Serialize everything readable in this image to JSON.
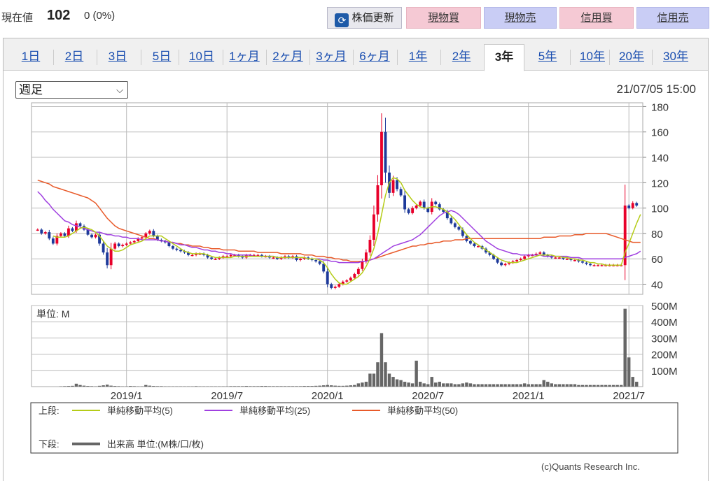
{
  "header": {
    "price_label": "現在値",
    "price_value": "102",
    "price_change": "0 (0%)",
    "buttons": {
      "refresh": "株価更新",
      "genbutsu_buy": "現物買",
      "genbutsu_sell": "現物売",
      "shinyo_buy": "信用買",
      "shinyo_sell": "信用売"
    }
  },
  "tabs": [
    "1日",
    "2日",
    "3日",
    "5日",
    "10日",
    "1ヶ月",
    "2ヶ月",
    "3ヶ月",
    "6ヶ月",
    "1年",
    "2年",
    "3年",
    "5年",
    "10年",
    "20年",
    "30年"
  ],
  "active_tab": "3年",
  "period_select": "週足",
  "datetime": "21/07/05 15:00",
  "copyright": "(c)Quants Research Inc.",
  "colors": {
    "up": "#e8002a",
    "down": "#1e3a9a",
    "ma5": "#b5cc18",
    "ma25": "#a040e0",
    "ma50": "#e85a2a",
    "volume": "#666666",
    "grid": "#aaaaaa"
  },
  "chart_data": {
    "type": "candlestick",
    "price_axis": {
      "ylim": [
        32,
        183
      ],
      "ticks": [
        40,
        60,
        80,
        100,
        120,
        140,
        160,
        180
      ]
    },
    "volume_axis": {
      "ylim": [
        0,
        500
      ],
      "ticks": [
        "100M",
        "200M",
        "300M",
        "400M",
        "500M"
      ],
      "unit_label": "単位: M"
    },
    "x_ticks": [
      "2019/1",
      "2019/7",
      "2020/1",
      "2020/7",
      "2021/1",
      "2021/7"
    ],
    "x_tick_weeks": [
      23,
      49,
      75,
      101,
      127,
      153
    ],
    "week_count": 156,
    "close": [
      83,
      80,
      81,
      76,
      72,
      78,
      80,
      78,
      84,
      82,
      88,
      86,
      83,
      79,
      77,
      79,
      72,
      65,
      55,
      68,
      72,
      70,
      71,
      72,
      73,
      74,
      76,
      77,
      80,
      82,
      78,
      75,
      74,
      73,
      70,
      68,
      67,
      66,
      65,
      63,
      63,
      64,
      64,
      63,
      61,
      60,
      60,
      61,
      62,
      62,
      63,
      63,
      62,
      61,
      63,
      63,
      63,
      63,
      62,
      62,
      61,
      61,
      60,
      61,
      62,
      61,
      62,
      59,
      60,
      61,
      60,
      59,
      58,
      56,
      50,
      40,
      37,
      38,
      40,
      42,
      43,
      45,
      48,
      52,
      58,
      65,
      75,
      95,
      118,
      160,
      128,
      112,
      122,
      115,
      110,
      99,
      96,
      100,
      102,
      105,
      100,
      97,
      105,
      103,
      99,
      97,
      92,
      88,
      85,
      83,
      78,
      74,
      72,
      70,
      70,
      68,
      65,
      63,
      60,
      57,
      55,
      56,
      57,
      58,
      59,
      60,
      62,
      63,
      63,
      64,
      65,
      63,
      62,
      61,
      61,
      61,
      60,
      60,
      59,
      59,
      58,
      57,
      56,
      55,
      55,
      55,
      55,
      55,
      55,
      55,
      55,
      55,
      102,
      100,
      104,
      102
    ],
    "ma5": [
      null,
      null,
      null,
      null,
      78,
      77,
      77,
      77,
      78,
      80,
      82,
      84,
      85,
      84,
      83,
      81,
      78,
      74,
      70,
      68,
      66,
      66,
      67,
      69,
      71,
      72,
      73,
      74,
      76,
      78,
      78,
      78,
      78,
      76,
      74,
      72,
      70,
      68,
      66,
      65,
      64,
      64,
      64,
      64,
      63,
      62,
      61,
      61,
      61,
      61,
      61,
      62,
      62,
      62,
      62,
      62,
      62,
      62,
      62,
      62,
      62,
      62,
      61,
      61,
      61,
      61,
      61,
      61,
      61,
      61,
      60,
      60,
      60,
      59,
      57,
      53,
      48,
      44,
      41,
      40,
      40,
      42,
      44,
      46,
      49,
      54,
      60,
      68,
      80,
      95,
      110,
      120,
      124,
      123,
      120,
      114,
      110,
      106,
      103,
      101,
      100,
      100,
      101,
      101,
      100,
      99,
      97,
      94,
      91,
      87,
      83,
      79,
      76,
      73,
      71,
      69,
      67,
      65,
      63,
      61,
      59,
      58,
      57,
      57,
      57,
      58,
      59,
      60,
      61,
      62,
      63,
      63,
      63,
      63,
      62,
      62,
      61,
      61,
      60,
      60,
      59,
      59,
      58,
      57,
      57,
      56,
      56,
      55,
      55,
      55,
      55,
      55,
      65,
      72,
      80,
      88,
      95
    ],
    "ma25": [
      113,
      110,
      106,
      103,
      99,
      96,
      93,
      90,
      89,
      87,
      86,
      85,
      84,
      83,
      82,
      81,
      81,
      80,
      79,
      79,
      78,
      78,
      77,
      77,
      76,
      76,
      76,
      75,
      75,
      75,
      75,
      75,
      74,
      74,
      73,
      73,
      72,
      71,
      71,
      70,
      69,
      69,
      68,
      67,
      67,
      66,
      66,
      65,
      65,
      64,
      64,
      63,
      63,
      63,
      63,
      63,
      62,
      62,
      62,
      62,
      62,
      62,
      61,
      61,
      61,
      61,
      61,
      61,
      61,
      61,
      60,
      60,
      60,
      60,
      59,
      59,
      58,
      58,
      57,
      57,
      57,
      57,
      57,
      57,
      58,
      58,
      59,
      60,
      62,
      64,
      66,
      68,
      70,
      71,
      72,
      73,
      74,
      75,
      77,
      79,
      82,
      85,
      88,
      91,
      94,
      96,
      97,
      98,
      97,
      95,
      92,
      89,
      86,
      83,
      80,
      77,
      74,
      72,
      70,
      68,
      67,
      66,
      65,
      64,
      64,
      63,
      63,
      63,
      63,
      63,
      63,
      62,
      62,
      62,
      62,
      62,
      62,
      62,
      61,
      61,
      61,
      60,
      60,
      60,
      60,
      60,
      60,
      60,
      60,
      60,
      60,
      60,
      61,
      62,
      63,
      64,
      66
    ],
    "ma50": [
      122,
      121,
      120,
      119,
      117,
      116,
      115,
      114,
      113,
      112,
      111,
      110,
      109,
      108,
      106,
      104,
      100,
      96,
      92,
      89,
      86,
      84,
      83,
      82,
      81,
      80,
      79,
      78,
      77,
      76,
      76,
      75,
      74,
      74,
      73,
      73,
      72,
      72,
      71,
      71,
      70,
      70,
      70,
      69,
      69,
      68,
      68,
      68,
      67,
      67,
      67,
      67,
      66,
      66,
      66,
      66,
      66,
      65,
      65,
      65,
      65,
      65,
      65,
      64,
      64,
      64,
      64,
      64,
      64,
      63,
      63,
      63,
      62,
      62,
      62,
      61,
      61,
      60,
      60,
      59,
      59,
      58,
      58,
      58,
      58,
      58,
      59,
      60,
      61,
      62,
      63,
      64,
      65,
      66,
      67,
      68,
      69,
      70,
      70,
      71,
      71,
      72,
      72,
      73,
      73,
      74,
      74,
      74,
      75,
      75,
      75,
      76,
      76,
      76,
      76,
      76,
      76,
      76,
      76,
      76,
      76,
      76,
      76,
      76,
      76,
      76,
      76,
      76,
      76,
      76,
      76,
      77,
      77,
      77,
      77,
      78,
      78,
      78,
      78,
      79,
      79,
      79,
      80,
      80,
      80,
      80,
      80,
      80,
      79,
      78,
      77,
      76,
      75,
      74,
      73,
      73,
      73
    ],
    "volume_m": [
      0,
      0,
      0,
      0,
      0,
      0,
      2,
      3,
      4,
      5,
      18,
      10,
      6,
      4,
      3,
      2,
      5,
      8,
      12,
      6,
      4,
      3,
      2,
      2,
      4,
      3,
      2,
      2,
      10,
      6,
      4,
      3,
      3,
      2,
      2,
      2,
      2,
      2,
      2,
      2,
      2,
      3,
      2,
      2,
      2,
      2,
      2,
      2,
      2,
      2,
      3,
      3,
      3,
      3,
      4,
      3,
      3,
      3,
      4,
      4,
      3,
      3,
      3,
      3,
      3,
      3,
      3,
      3,
      3,
      4,
      4,
      4,
      5,
      6,
      8,
      10,
      8,
      6,
      5,
      5,
      6,
      8,
      10,
      20,
      25,
      30,
      80,
      80,
      150,
      330,
      150,
      80,
      60,
      45,
      40,
      30,
      25,
      20,
      160,
      30,
      20,
      15,
      60,
      25,
      30,
      20,
      20,
      20,
      15,
      15,
      20,
      25,
      20,
      15,
      15,
      15,
      15,
      15,
      15,
      15,
      15,
      15,
      15,
      15,
      15,
      15,
      20,
      15,
      15,
      15,
      15,
      40,
      30,
      20,
      15,
      15,
      15,
      15,
      15,
      15,
      10,
      10,
      10,
      10,
      10,
      10,
      10,
      10,
      10,
      10,
      10,
      10,
      480,
      180,
      60,
      30
    ],
    "legend": {
      "upper_label": "上段:",
      "lower_label": "下段:",
      "series": [
        {
          "name": "単純移動平均(5)",
          "color": "#b5cc18"
        },
        {
          "name": "単純移動平均(25)",
          "color": "#a040e0"
        },
        {
          "name": "単純移動平均(50)",
          "color": "#e85a2a"
        }
      ],
      "volume_entry": "出来高 単位:(M株/口/枚)"
    }
  }
}
